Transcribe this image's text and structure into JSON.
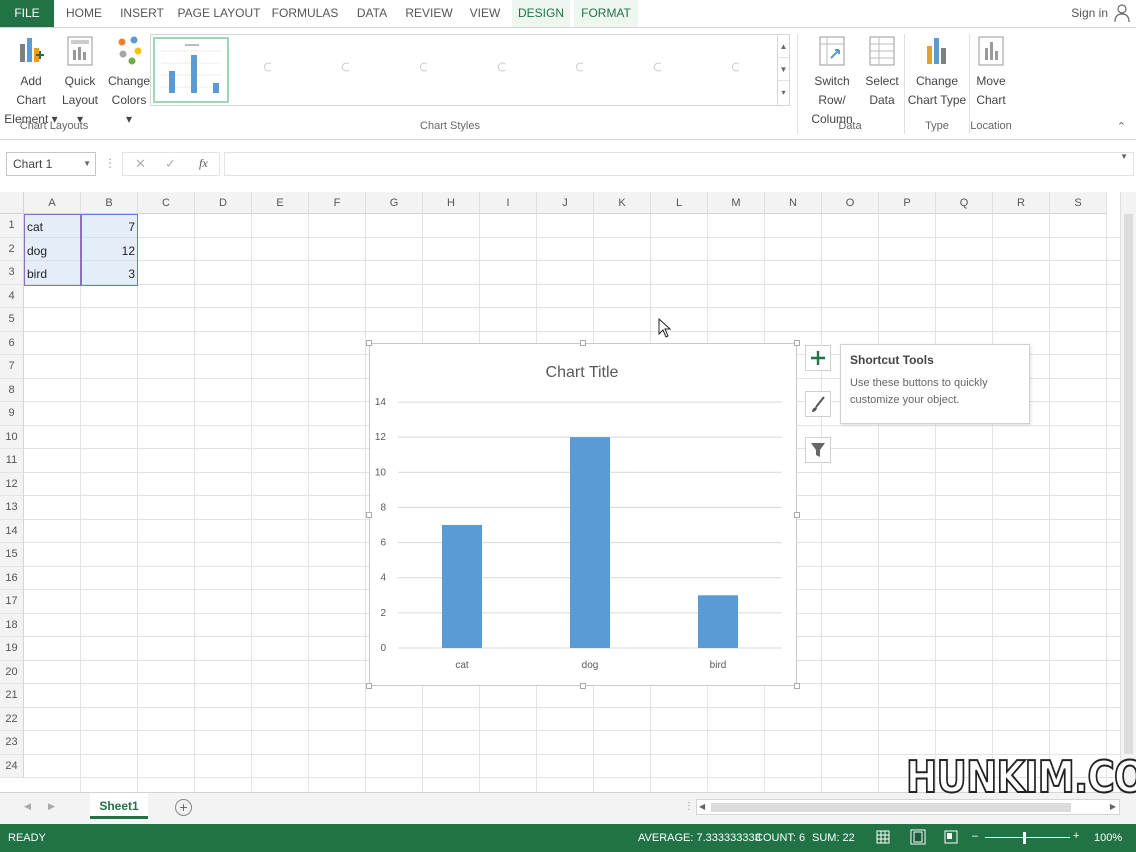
{
  "tabs": [
    {
      "label": "FILE",
      "kind": "file"
    },
    {
      "label": "HOME"
    },
    {
      "label": "INSERT"
    },
    {
      "label": "PAGE LAYOUT"
    },
    {
      "label": "FORMULAS"
    },
    {
      "label": "DATA"
    },
    {
      "label": "REVIEW"
    },
    {
      "label": "VIEW"
    },
    {
      "label": "DESIGN",
      "kind": "ctx"
    },
    {
      "label": "FORMAT",
      "kind": "ctx"
    }
  ],
  "signin": "Sign in",
  "ribbon": {
    "add_chart_element": [
      "Add Chart",
      "Element ▾"
    ],
    "quick_layout": [
      "Quick",
      "Layout ▾"
    ],
    "change_colors": [
      "Change",
      "Colors ▾"
    ],
    "switch_row_column": [
      "Switch Row/",
      "Column"
    ],
    "select_data": [
      "Select",
      "Data"
    ],
    "change_chart_type": [
      "Change",
      "Chart Type"
    ],
    "move_chart": [
      "Move",
      "Chart"
    ],
    "groups": {
      "chart_layouts": "Chart Layouts",
      "chart_styles": "Chart Styles",
      "data": "Data",
      "type": "Type",
      "location": "Location"
    }
  },
  "formula_bar": {
    "name_box": "Chart 1",
    "fx": "fx",
    "formula": ""
  },
  "columns": [
    "A",
    "B",
    "C",
    "D",
    "E",
    "F",
    "G",
    "H",
    "I",
    "J",
    "K",
    "L",
    "M",
    "N",
    "O",
    "P",
    "Q",
    "R",
    "S"
  ],
  "rows": [
    "1",
    "2",
    "3",
    "4",
    "5",
    "6",
    "7",
    "8",
    "9",
    "10",
    "11",
    "12",
    "13",
    "14",
    "15",
    "16",
    "17",
    "18",
    "19",
    "20",
    "21",
    "22",
    "23",
    "24"
  ],
  "cells": [
    {
      "label": "cat",
      "value": "7"
    },
    {
      "label": "dog",
      "value": "12"
    },
    {
      "label": "bird",
      "value": "3"
    }
  ],
  "chart_data": {
    "type": "bar",
    "title": "Chart Title",
    "categories": [
      "cat",
      "dog",
      "bird"
    ],
    "values": [
      7,
      12,
      3
    ],
    "ylim": [
      0,
      14
    ],
    "yticks": [
      "0",
      "2",
      "4",
      "6",
      "8",
      "10",
      "12",
      "14"
    ],
    "grid": true,
    "xlabel": "",
    "ylabel": "",
    "color": "#5b9bd5"
  },
  "tooltip": {
    "title": "Shortcut Tools",
    "body": "Use these buttons to quickly customize your object."
  },
  "sheet": {
    "tab": "Sheet1",
    "add": "+"
  },
  "status": {
    "ready": "READY",
    "average": "AVERAGE: 7.333333333",
    "count": "COUNT: 6",
    "sum": "SUM: 22",
    "zoom": "100%"
  },
  "watermark": "HUNKIM.COM",
  "colors": {
    "excel_green": "#217346",
    "bar_blue": "#5b9bd5"
  }
}
